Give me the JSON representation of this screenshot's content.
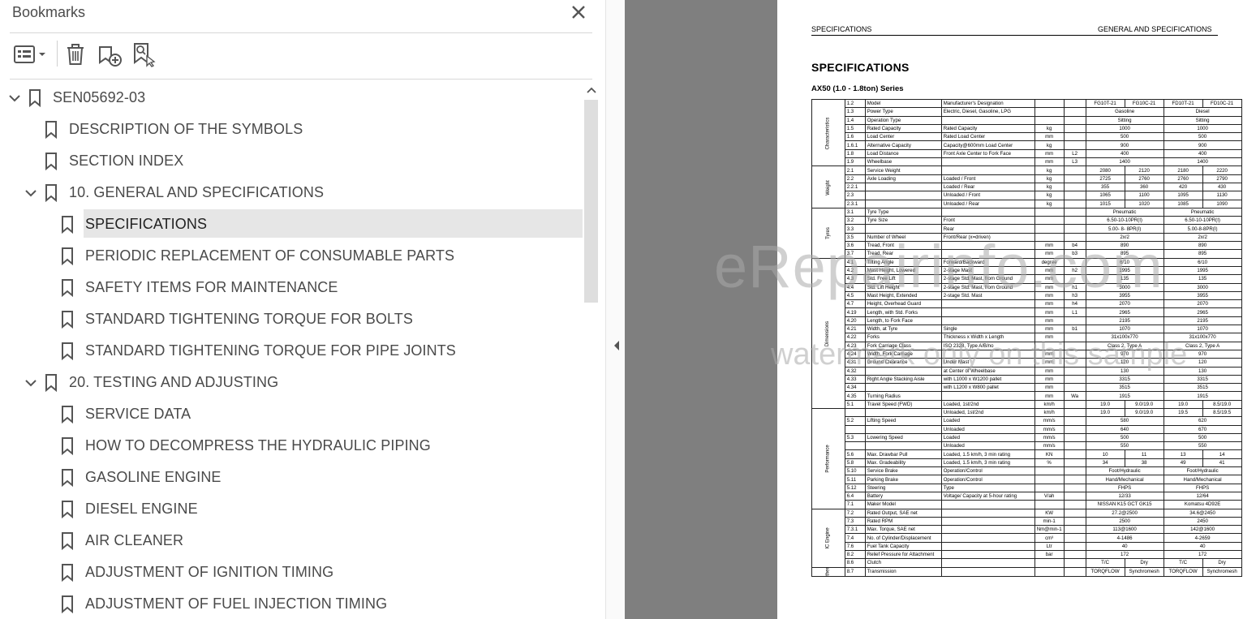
{
  "bookmarks": {
    "title": "Bookmarks",
    "toolbar": {
      "options_icon": "list-options-icon",
      "delete_icon": "trash-icon",
      "add_icon": "add-bookmark-icon",
      "find_icon": "find-bookmark-icon"
    },
    "items": [
      {
        "label": "SEN05692-03",
        "level": 0,
        "expanded": true
      },
      {
        "label": "DESCRIPTION OF THE SYMBOLS",
        "level": 1
      },
      {
        "label": "SECTION INDEX",
        "level": 1
      },
      {
        "label": "10. GENERAL AND SPECIFICATIONS",
        "level": 1,
        "expanded": true
      },
      {
        "label": "SPECIFICATIONS",
        "level": 2,
        "selected": true
      },
      {
        "label": "PERIODIC REPLACEMENT OF CONSUMABLE PARTS",
        "level": 2
      },
      {
        "label": "SAFETY ITEMS FOR MAINTENANCE",
        "level": 2
      },
      {
        "label": "STANDARD TIGHTENING TORQUE FOR BOLTS",
        "level": 2
      },
      {
        "label": "STANDARD TIGHTENING TORQUE FOR PIPE JOINTS",
        "level": 2
      },
      {
        "label": "20. TESTING AND ADJUSTING",
        "level": 1,
        "expanded": true
      },
      {
        "label": "SERVICE DATA",
        "level": 2
      },
      {
        "label": "HOW TO DECOMPRESS THE HYDRAULIC PIPING",
        "level": 2
      },
      {
        "label": "GASOLINE ENGINE",
        "level": 2
      },
      {
        "label": "DIESEL ENGINE",
        "level": 2
      },
      {
        "label": "AIR CLEANER",
        "level": 2
      },
      {
        "label": "ADJUSTMENT OF IGNITION TIMING",
        "level": 2
      },
      {
        "label": "ADJUSTMENT OF FUEL INJECTION TIMING",
        "level": 2
      }
    ]
  },
  "document": {
    "header_left": "SPECIFICATIONS",
    "header_right": "GENERAL AND SPECIFICATIONS",
    "title": "SPECIFICATIONS",
    "subtitle": "AX50 (1.0 - 1.8ton) Series",
    "watermark_main": "eRepairinfo.com",
    "watermark_sub": "watermark only on this sample",
    "groups": [
      {
        "name": "Characteristics",
        "rows": 8
      },
      {
        "name": "Weight",
        "rows": 5
      },
      {
        "name": "Tyres",
        "rows": 6
      },
      {
        "name": "Dimensions",
        "rows": 18
      },
      {
        "name": "Performance",
        "rows": 12
      },
      {
        "name": "IC Engine",
        "rows": 7
      },
      {
        "name": "Others",
        "rows": 3
      }
    ],
    "rows": [
      [
        "1.2",
        "Model",
        "Manufacturer's Designation",
        "",
        "",
        "FG10T-21",
        "FG10C-21",
        "FD10T-21",
        "FD10C-21"
      ],
      [
        "1.3",
        "Power Type",
        "Electric, Diesel, Gasoline, LPG",
        "",
        "",
        "Gasoline",
        "",
        "Diesel",
        ""
      ],
      [
        "1.4",
        "Operation Type",
        "",
        "",
        "",
        "Sitting",
        "",
        "Sitting",
        ""
      ],
      [
        "1.5",
        "Rated Capacity",
        "Rated Capacity",
        "kg",
        "",
        "1000",
        "",
        "1000",
        ""
      ],
      [
        "1.6",
        "Load Center",
        "Rated Load Center",
        "mm",
        "",
        "500",
        "",
        "500",
        ""
      ],
      [
        "1.6.1",
        "Alternative Capacity",
        "Capacity@600mm Load Center",
        "kg",
        "",
        "900",
        "",
        "900",
        ""
      ],
      [
        "1.8",
        "Load Distance",
        "Front Axle Center to Fork Face",
        "mm",
        "L2",
        "400",
        "",
        "400",
        ""
      ],
      [
        "1.9",
        "Wheelbase",
        "",
        "mm",
        "L3",
        "1400",
        "",
        "1400",
        ""
      ],
      [
        "2.1",
        "Service Weight",
        "",
        "kg",
        "",
        "2080",
        "2120",
        "2180",
        "2220"
      ],
      [
        "2.2",
        "Axle Loading",
        "Loaded / Front",
        "kg",
        "",
        "2725",
        "2760",
        "2760",
        "2790"
      ],
      [
        "2.2.1",
        "",
        "Loaded / Rear",
        "kg",
        "",
        "355",
        "360",
        "420",
        "430"
      ],
      [
        "2.3",
        "",
        "Unloaded / Front",
        "kg",
        "",
        "1065",
        "1100",
        "1095",
        "1130"
      ],
      [
        "2.3.1",
        "",
        "Unloaded / Rear",
        "kg",
        "",
        "1015",
        "1020",
        "1085",
        "1090"
      ],
      [
        "3.1",
        "Tyre Type",
        "",
        "",
        "",
        "Pneumatic",
        "",
        "Pneumatic",
        ""
      ],
      [
        "3.2",
        "Tyre Size",
        "Front",
        "",
        "",
        "6.50-10-10PR(I)",
        "",
        "6.50-10-10PR(I)",
        ""
      ],
      [
        "3.3",
        "",
        "Rear",
        "",
        "",
        "5.00- 8- 8PR(I)",
        "",
        "5.00-8-8PR(I)",
        ""
      ],
      [
        "3.5",
        "Number of Wheel",
        "Front/Rear (x=driven)",
        "",
        "",
        "2x/2",
        "",
        "2x/2",
        ""
      ],
      [
        "3.6",
        "Tread, Front",
        "",
        "mm",
        "b4",
        "890",
        "",
        "890",
        ""
      ],
      [
        "3.7",
        "Tread, Rear",
        "",
        "mm",
        "b3",
        "895",
        "",
        "895",
        ""
      ],
      [
        "4.1",
        "Tilting Angle",
        "Forward/Backward",
        "degree",
        "",
        "6/10",
        "",
        "6/10",
        ""
      ],
      [
        "4.2",
        "Mast Height, Lowered",
        "2-stage Mast",
        "mm",
        "h2",
        "1995",
        "",
        "1995",
        ""
      ],
      [
        "4.3",
        "Std. Free Lift",
        "2-stage Std. Mast, from Ground",
        "mm",
        "",
        "135",
        "",
        "135",
        ""
      ],
      [
        "4.4",
        "Std. Lift Height",
        "2-stage Std. Mast, from Ground",
        "mm",
        "h1",
        "3000",
        "",
        "3000",
        ""
      ],
      [
        "4.5",
        "Mast Height, Extended",
        "2-stage Std. Mast",
        "mm",
        "h3",
        "3955",
        "",
        "3955",
        ""
      ],
      [
        "4.7",
        "Height, Overhead Guard",
        "",
        "mm",
        "h4",
        "2070",
        "",
        "2070",
        ""
      ],
      [
        "4.19",
        "Length, with Std. Forks",
        "",
        "mm",
        "L1",
        "2965",
        "",
        "2965",
        ""
      ],
      [
        "4.20",
        "Length, to Fork Face",
        "",
        "mm",
        "",
        "2195",
        "",
        "2195",
        ""
      ],
      [
        "4.21",
        "Width, at Tyre",
        "Single",
        "mm",
        "b1",
        "1070",
        "",
        "1070",
        ""
      ],
      [
        "4.22",
        "Forks",
        "Thickness x Width x Length",
        "mm",
        "",
        "31x100x770",
        "",
        "31x100x770",
        ""
      ],
      [
        "4.23",
        "Fork Carriage Class",
        "ISO 2328, Type A/B/no",
        "",
        "",
        "Class 2, Type A",
        "",
        "Class 2, Type A",
        ""
      ],
      [
        "4.24",
        "Width, Fork Carriage",
        "",
        "mm",
        "",
        "970",
        "",
        "970",
        ""
      ],
      [
        "4.31",
        "Ground Clearance",
        "Under Mast",
        "mm",
        "",
        "120",
        "",
        "120",
        ""
      ],
      [
        "4.32",
        "",
        "at Center of Wheelbase",
        "mm",
        "",
        "130",
        "",
        "130",
        ""
      ],
      [
        "4.33",
        "Right Angle Stacking Aisle",
        "with L1000 x W1200 pallet",
        "mm",
        "",
        "3315",
        "",
        "3315",
        ""
      ],
      [
        "4.34",
        "",
        "with L1200 x W800 pallet",
        "mm",
        "",
        "3515",
        "",
        "3515",
        ""
      ],
      [
        "4.35",
        "Turning Radius",
        "",
        "mm",
        "Wa",
        "1915",
        "",
        "1915",
        ""
      ],
      [
        "5.1",
        "Travel Speed (FWD)",
        "Loaded, 1st/2nd",
        "km/h",
        "",
        "19.0",
        "9.0/19.0",
        "19.0",
        "8.5/19.0"
      ],
      [
        "",
        "",
        "Unloaded, 1st/2nd",
        "km/h",
        "",
        "19.0",
        "9.0/19.0",
        "19.5",
        "8.5/19.5"
      ],
      [
        "5.2",
        "Lifting Speed",
        "Loaded",
        "mm/s",
        "",
        "580",
        "",
        "620",
        ""
      ],
      [
        "",
        "",
        "Unloaded",
        "mm/s",
        "",
        "640",
        "",
        "670",
        ""
      ],
      [
        "5.3",
        "Lowering Speed",
        "Loaded",
        "mm/s",
        "",
        "500",
        "",
        "500",
        ""
      ],
      [
        "",
        "",
        "Unloaded",
        "mm/s",
        "",
        "550",
        "",
        "550",
        ""
      ],
      [
        "5.6",
        "Max. Drawbar Pull",
        "Loaded, 1.5 km/h, 3 min rating",
        "KN",
        "",
        "10",
        "11",
        "13",
        "14"
      ],
      [
        "5.8",
        "Max. Gradeability",
        "Loaded, 1.5 km/h, 3 min rating",
        "%",
        "",
        "34",
        "38",
        "49",
        "41"
      ],
      [
        "5.10",
        "Service Brake",
        "Operation/Control",
        "",
        "",
        "Foot/Hydraulic",
        "",
        "Foot/Hydraulic",
        ""
      ],
      [
        "5.11",
        "Parking Brake",
        "Operation/Control",
        "",
        "",
        "Hand/Mechanical",
        "",
        "Hand/Mechanical",
        ""
      ],
      [
        "5.12",
        "Steering",
        "Type",
        "",
        "",
        "FHPS",
        "",
        "FHPS",
        ""
      ],
      [
        "6.4",
        "Battery",
        "Voltage/ Capacity at 5-hour rating",
        "V/ah",
        "",
        "12/33",
        "",
        "12/64",
        ""
      ],
      [
        "7.1",
        "Maker Model",
        "",
        "",
        "",
        "NISSAN K15 GCT GK15",
        "",
        "Komatsu 4D92E",
        ""
      ],
      [
        "7.2",
        "Rated Output, SAE net",
        "",
        "KW",
        "",
        "27.2@2500",
        "",
        "34.6@2450",
        ""
      ],
      [
        "7.3",
        "Rated RPM",
        "",
        "min-1",
        "",
        "2500",
        "",
        "2450",
        ""
      ],
      [
        "7.3.1",
        "Max. Torque, SAE net",
        "",
        "Nm@min-1",
        "",
        "113@1600",
        "",
        "142@1600",
        ""
      ],
      [
        "7.4",
        "No. of Cylinder/Displacement",
        "",
        "cm³",
        "",
        "4-1486",
        "",
        "4-2659",
        ""
      ],
      [
        "7.6",
        "Fuel Tank Capacity",
        "",
        "Ltr",
        "",
        "40",
        "",
        "40",
        ""
      ],
      [
        "8.2",
        "Relief Pressure for Attachment",
        "",
        "bar",
        "",
        "172",
        "",
        "172",
        ""
      ],
      [
        "8.6",
        "Clutch",
        "",
        "",
        "",
        "T/C",
        "Dry",
        "T/C",
        "Dry"
      ],
      [
        "8.7",
        "Transmission",
        "",
        "",
        "",
        "TORQFLOW",
        "Synchromesh",
        "TORQFLOW",
        "Synchromesh"
      ]
    ]
  },
  "colors": {
    "panel_bg": "#ffffff",
    "selected_row": "#e6e6e6",
    "doc_bg": "#7f7f7f",
    "icon": "#5a5a5a"
  }
}
